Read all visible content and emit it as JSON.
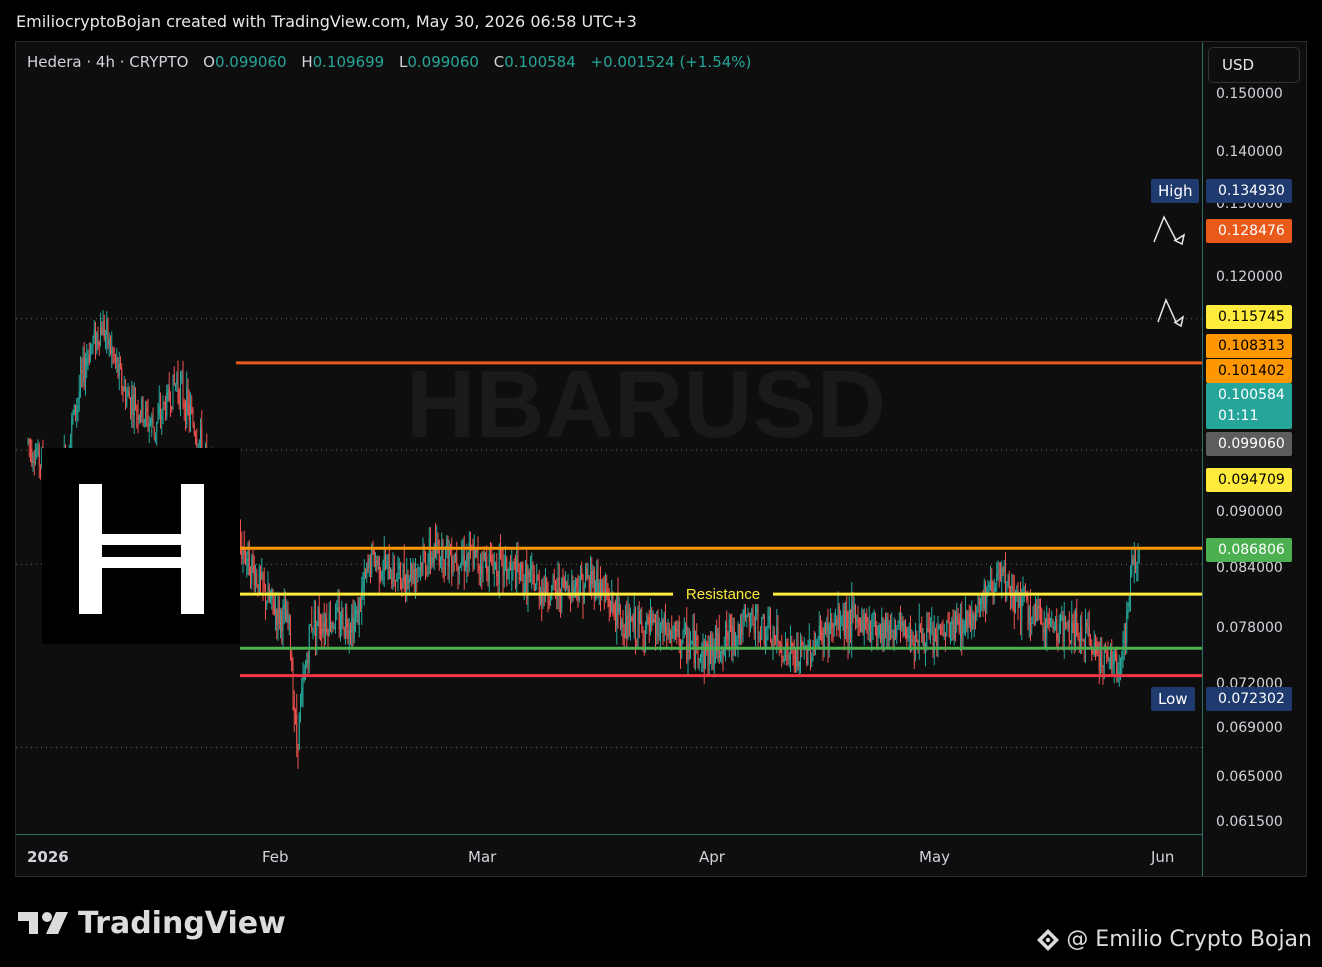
{
  "header": {
    "title": "EmiliocryptoBojan created with TradingView.com, May 30, 2026 06:58 UTC+3"
  },
  "legend": {
    "symbol": "Hedera · 4h · CRYPTO",
    "open_label": "O",
    "open": "0.099060",
    "high_label": "H",
    "high": "0.109699",
    "low_label": "L",
    "low": "0.099060",
    "close_label": "C",
    "close": "0.100584",
    "change": "+0.001524 (+1.54%)"
  },
  "watermark": "HBARUSD",
  "currency_button": "USD",
  "price_axis_ticks": [
    "0.150000",
    "0.140000",
    "0.130000",
    "0.120000",
    "0.090000",
    "0.084000",
    "0.078000",
    "0.072000",
    "0.069000",
    "0.065000",
    "0.061500"
  ],
  "high_tag": {
    "label": "High",
    "value": "0.134930"
  },
  "low_tag": {
    "label": "Low",
    "value": "0.072302"
  },
  "level_labels": [
    {
      "value": "0.128476",
      "color": "#e8591a",
      "text_color": "#ffffff"
    },
    {
      "value": "0.115745",
      "color": "#ffeb3b",
      "text_color": "#000000"
    },
    {
      "value": "0.108313",
      "color": "#ff9800",
      "text_color": "#000000"
    },
    {
      "value": "0.101402",
      "color": "#ff9800",
      "text_color": "#000000"
    },
    {
      "value": "0.099060",
      "color": "#5d5d5d",
      "text_color": "#ffffff"
    },
    {
      "value": "0.094709",
      "color": "#ffeb3b",
      "text_color": "#000000"
    },
    {
      "value": "0.086806",
      "color": "#4caf50",
      "text_color": "#ffffff"
    }
  ],
  "current_price": {
    "value": "0.100584",
    "countdown": "01:11",
    "color": "#26a69a"
  },
  "resistance_label": "Resistance",
  "time_axis": [
    "2026",
    "Feb",
    "Mar",
    "Apr",
    "May",
    "Jun"
  ],
  "branding": {
    "logo_text": "TradingView",
    "author": "@ Emilio Crypto Bojan"
  },
  "colors": {
    "up": "#26a69a",
    "down": "#ef5350",
    "background": "#0e0e0e"
  },
  "chart_data": {
    "type": "candlestick",
    "symbol": "HBARUSD",
    "timeframe": "4h",
    "x_range": [
      "2026-01-01",
      "2026-05-30"
    ],
    "y_range": [
      0.0615,
      0.152
    ],
    "horizontal_levels": [
      {
        "price": 0.128476,
        "color": "#e8591a"
      },
      {
        "price": 0.101402,
        "color": "#ff9800"
      },
      {
        "price": 0.094709,
        "color": "#ffeb3b",
        "label": "Resistance"
      },
      {
        "price": 0.086806,
        "color": "#4caf50"
      },
      {
        "price": 0.0828,
        "color": "#f23645"
      }
    ],
    "dotted_levels": [
      0.13493,
      0.115745,
      0.09906,
      0.072302
    ],
    "price_path": [
      {
        "date": "2026-01-01",
        "price": 0.117
      },
      {
        "date": "2026-01-05",
        "price": 0.11
      },
      {
        "date": "2026-01-09",
        "price": 0.13
      },
      {
        "date": "2026-01-11",
        "price": 0.134
      },
      {
        "date": "2026-01-14",
        "price": 0.124
      },
      {
        "date": "2026-01-18",
        "price": 0.119
      },
      {
        "date": "2026-01-21",
        "price": 0.126
      },
      {
        "date": "2026-01-24",
        "price": 0.117
      },
      {
        "date": "2026-01-27",
        "price": 0.105
      },
      {
        "date": "2026-01-30",
        "price": 0.101
      },
      {
        "date": "2026-02-02",
        "price": 0.094
      },
      {
        "date": "2026-02-05",
        "price": 0.09
      },
      {
        "date": "2026-02-06",
        "price": 0.073
      },
      {
        "date": "2026-02-08",
        "price": 0.091
      },
      {
        "date": "2026-02-14",
        "price": 0.091
      },
      {
        "date": "2026-02-16",
        "price": 0.1
      },
      {
        "date": "2026-02-20",
        "price": 0.097
      },
      {
        "date": "2026-02-25",
        "price": 0.101
      },
      {
        "date": "2026-03-05",
        "price": 0.099
      },
      {
        "date": "2026-03-12",
        "price": 0.095
      },
      {
        "date": "2026-03-18",
        "price": 0.097
      },
      {
        "date": "2026-03-22",
        "price": 0.09
      },
      {
        "date": "2026-03-28",
        "price": 0.089
      },
      {
        "date": "2026-04-02",
        "price": 0.086
      },
      {
        "date": "2026-04-08",
        "price": 0.091
      },
      {
        "date": "2026-04-14",
        "price": 0.085
      },
      {
        "date": "2026-04-20",
        "price": 0.091
      },
      {
        "date": "2026-04-26",
        "price": 0.09
      },
      {
        "date": "2026-05-02",
        "price": 0.088
      },
      {
        "date": "2026-05-07",
        "price": 0.091
      },
      {
        "date": "2026-05-11",
        "price": 0.097
      },
      {
        "date": "2026-05-16",
        "price": 0.091
      },
      {
        "date": "2026-05-22",
        "price": 0.089
      },
      {
        "date": "2026-05-27",
        "price": 0.084
      },
      {
        "date": "2026-05-28",
        "price": 0.088
      },
      {
        "date": "2026-05-29",
        "price": 0.099
      },
      {
        "date": "2026-05-30",
        "price": 0.1006
      }
    ]
  }
}
